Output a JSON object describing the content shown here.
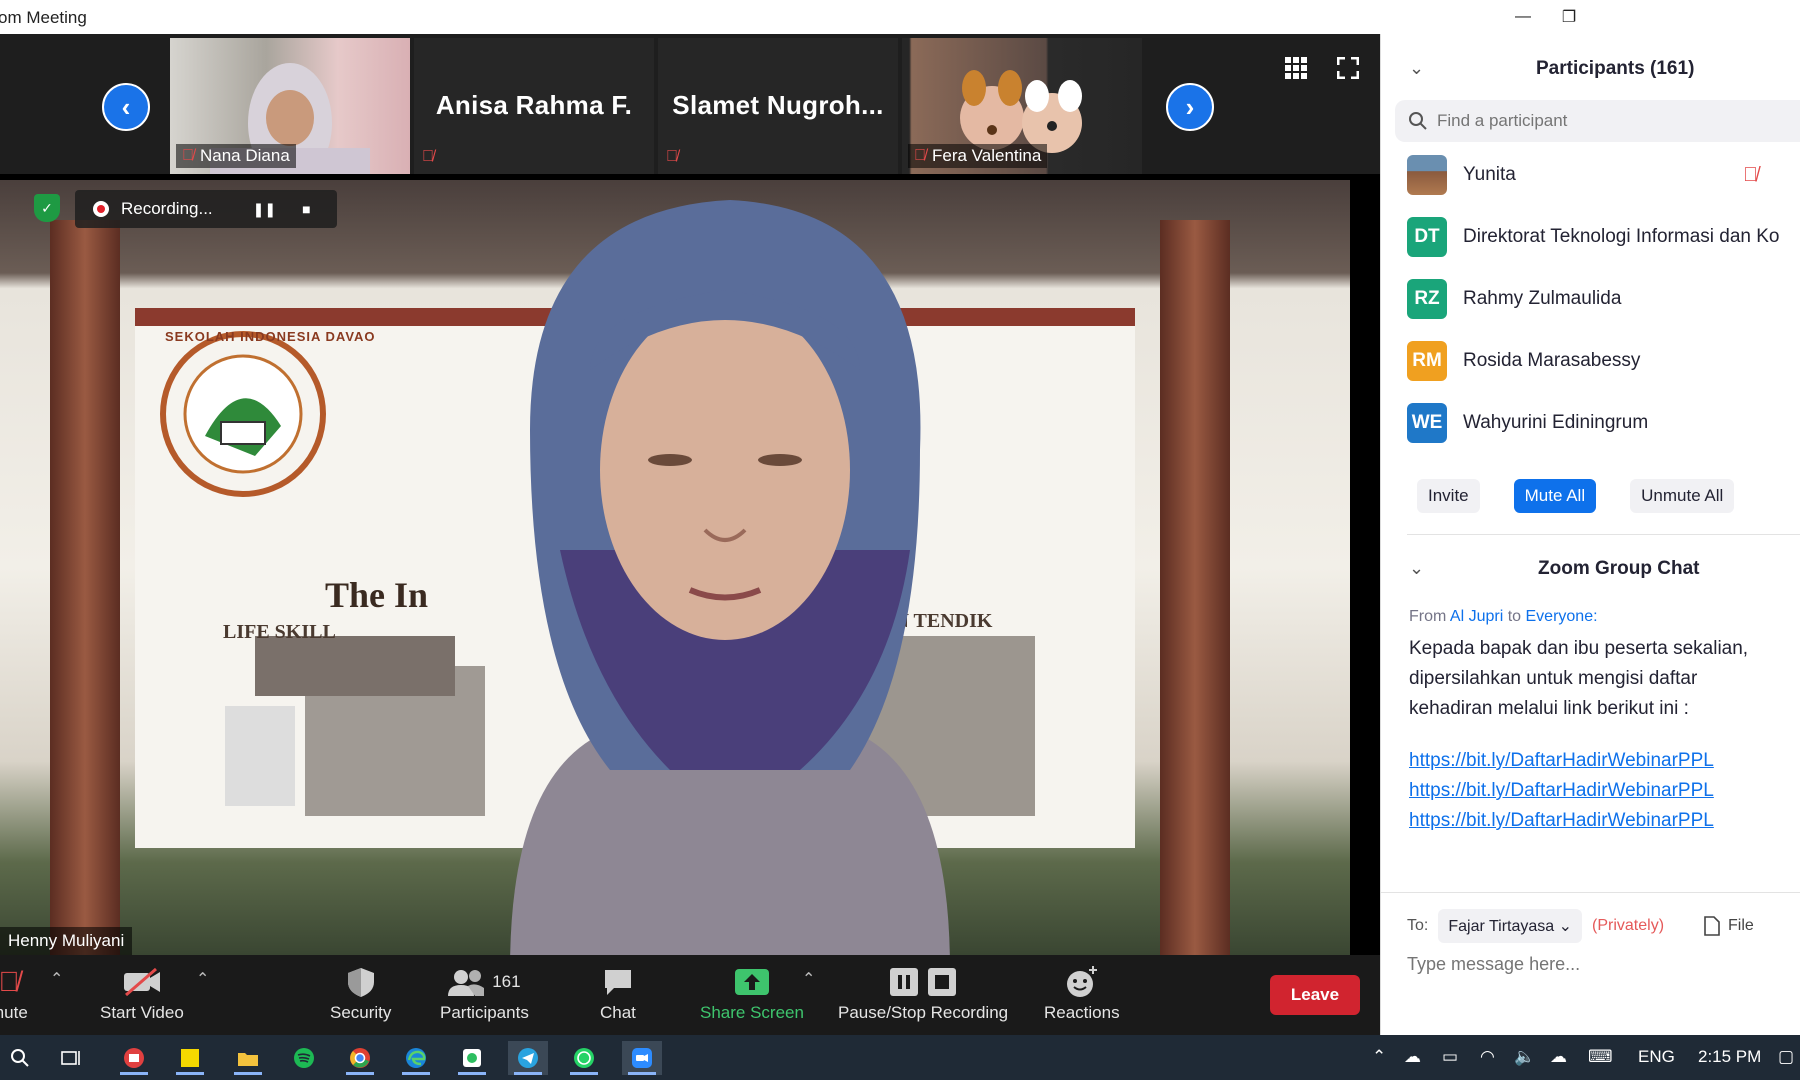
{
  "window": {
    "title": "om Meeting",
    "minimize_label": "—",
    "restore_label": "❐"
  },
  "thumbnails": [
    {
      "name": "Nana Diana",
      "muted": true,
      "has_video": true
    },
    {
      "name": "Anisa Rahma F.",
      "muted": true,
      "has_video": false
    },
    {
      "name": "Slamet  Nugroh...",
      "muted": true,
      "has_video": false
    },
    {
      "name": "Fera Valentina",
      "muted": true,
      "has_video": true
    }
  ],
  "main_video": {
    "speaker": "Henny Muliyani",
    "recording_label": "Recording...",
    "banner_text_1": "The In",
    "banner_text_2": "LIFE SKILL",
    "banner_text_3": "EMBANGAN TENDIK",
    "banner_text_4": "SEKOLAH INDONESIA DAVAO"
  },
  "toolbar": {
    "mute_label": "mute",
    "start_video_label": "Start Video",
    "security_label": "Security",
    "participants_label": "Participants",
    "participants_count": "161",
    "chat_label": "Chat",
    "share_screen_label": "Share Screen",
    "pause_stop_recording_label": "Pause/Stop Recording",
    "reactions_label": "Reactions",
    "leave_label": "Leave"
  },
  "participants_panel": {
    "title": "Participants (161)",
    "search_placeholder": "Find a participant",
    "list": [
      {
        "initials": "",
        "name": "Yunita",
        "color": "#8a6b4e",
        "muted": true
      },
      {
        "initials": "DT",
        "name": "Direktorat Teknologi Informasi dan Ko",
        "color": "#1aa57a",
        "muted": false
      },
      {
        "initials": "RZ",
        "name": "Rahmy Zulmaulida",
        "color": "#1aa57a",
        "muted": false
      },
      {
        "initials": "RM",
        "name": "Rosida Marasabessy",
        "color": "#f0a020",
        "muted": false
      },
      {
        "initials": "WE",
        "name": "Wahyurini Ediningrum",
        "color": "#1f78c8",
        "muted": false
      }
    ],
    "invite_label": "Invite",
    "mute_all_label": "Mute All",
    "unmute_all_label": "Unmute All"
  },
  "chat_panel": {
    "title": "Zoom Group Chat",
    "from_prefix": "From",
    "sender": "Al Jupri",
    "to_word": "to",
    "recipient": "Everyone:",
    "message": "Kepada bapak dan ibu peserta sekalian, dipersilahkan untuk mengisi daftar kehadiran melalui link berikut ini :",
    "links": [
      "https://bit.ly/DaftarHadirWebinarPPL",
      "https://bit.ly/DaftarHadirWebinarPPL",
      "https://bit.ly/DaftarHadirWebinarPPL"
    ],
    "to_label": "To:",
    "to_value": "Fajar Tirtayasa",
    "privately_label": "(Privately)",
    "file_label": "File",
    "input_placeholder": "Type message here..."
  },
  "taskbar": {
    "language": "ENG",
    "time": "2:15 PM"
  }
}
